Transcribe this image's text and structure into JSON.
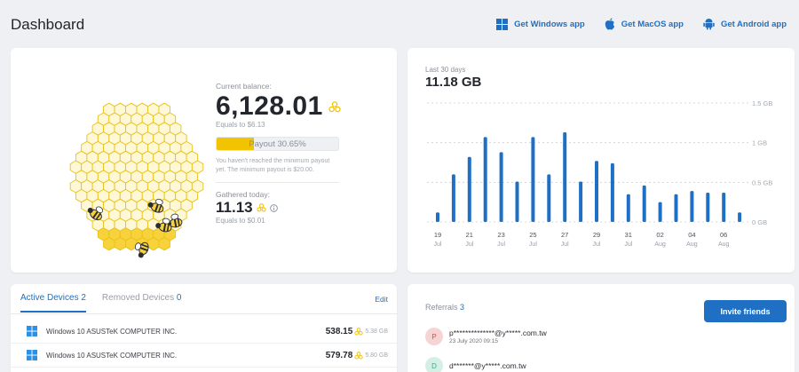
{
  "header": {
    "title": "Dashboard",
    "apps": [
      {
        "label": "Get Windows app",
        "icon": "windows-icon"
      },
      {
        "label": "Get MacOS app",
        "icon": "apple-icon"
      },
      {
        "label": "Get Android app",
        "icon": "android-icon"
      }
    ]
  },
  "balance": {
    "current_label": "Current balance:",
    "current_value": "6,128.01",
    "current_equals": "Equals to $6.13",
    "payout_label": "Payout 30.65%",
    "payout_fraction": 0.3065,
    "note": "You haven't reached the minimum payout yet. The minimum payout is $20.00.",
    "today_label": "Gathered today:",
    "today_value": "11.13",
    "today_equals": "Equals to $0.01",
    "colors": {
      "honey": "#f2c300",
      "hex_stroke": "#e8c21a"
    }
  },
  "chart": {
    "period_label": "Last 30 days",
    "total": "11.18 GB",
    "accent": "#1f6fc4"
  },
  "chart_data": {
    "type": "bar",
    "title": "",
    "xlabel": "",
    "ylabel": "",
    "ylim": [
      0,
      1.5
    ],
    "y_ticks": [
      "1.5 GB",
      "1 GB",
      "0.5 GB",
      "0 GB"
    ],
    "x_ticks": [
      {
        "day": "19",
        "month": "Jul"
      },
      {
        "day": "21",
        "month": "Jul"
      },
      {
        "day": "23",
        "month": "Jul"
      },
      {
        "day": "25",
        "month": "Jul"
      },
      {
        "day": "27",
        "month": "Jul"
      },
      {
        "day": "29",
        "month": "Jul"
      },
      {
        "day": "31",
        "month": "Jul"
      },
      {
        "day": "02",
        "month": "Aug"
      },
      {
        "day": "04",
        "month": "Aug"
      },
      {
        "day": "06",
        "month": "Aug"
      }
    ],
    "categories": [
      "19 Jul",
      "20 Jul",
      "21 Jul",
      "22 Jul",
      "23 Jul",
      "24 Jul",
      "25 Jul",
      "26 Jul",
      "27 Jul",
      "28 Jul",
      "29 Jul",
      "30 Jul",
      "31 Jul",
      "01 Aug",
      "02 Aug",
      "03 Aug",
      "04 Aug",
      "05 Aug",
      "06 Aug",
      "07 Aug"
    ],
    "values": [
      0.12,
      0.6,
      0.82,
      1.07,
      0.88,
      0.51,
      1.07,
      0.6,
      1.13,
      0.51,
      0.77,
      0.74,
      0.35,
      0.46,
      0.25,
      0.35,
      0.39,
      0.37,
      0.37,
      0.12
    ],
    "grid": true
  },
  "devices": {
    "active_tab": "Active Devices",
    "active_count": "2",
    "removed_tab": "Removed Devices",
    "removed_count": "0",
    "edit_label": "Edit",
    "rows": [
      {
        "name": "Windows 10 ASUSTeK COMPUTER INC.",
        "value": "538.15",
        "gb": "5.38 GB"
      },
      {
        "name": "Windows 10 ASUSTeK COMPUTER INC.",
        "value": "579.78",
        "gb": "5.80 GB"
      }
    ]
  },
  "referrals": {
    "title": "Referrals",
    "count": "3",
    "invite_label": "Invite friends",
    "rows": [
      {
        "initial": "P",
        "email": "p**************@y*****.com.tw",
        "date": "23 July 2020 09:15",
        "color": "#f7d4d4",
        "text_color": "#c55"
      },
      {
        "initial": "D",
        "email": "d*******@y*****.com.tw",
        "date": "",
        "color": "#d4f0e4",
        "text_color": "#3a9"
      }
    ]
  }
}
